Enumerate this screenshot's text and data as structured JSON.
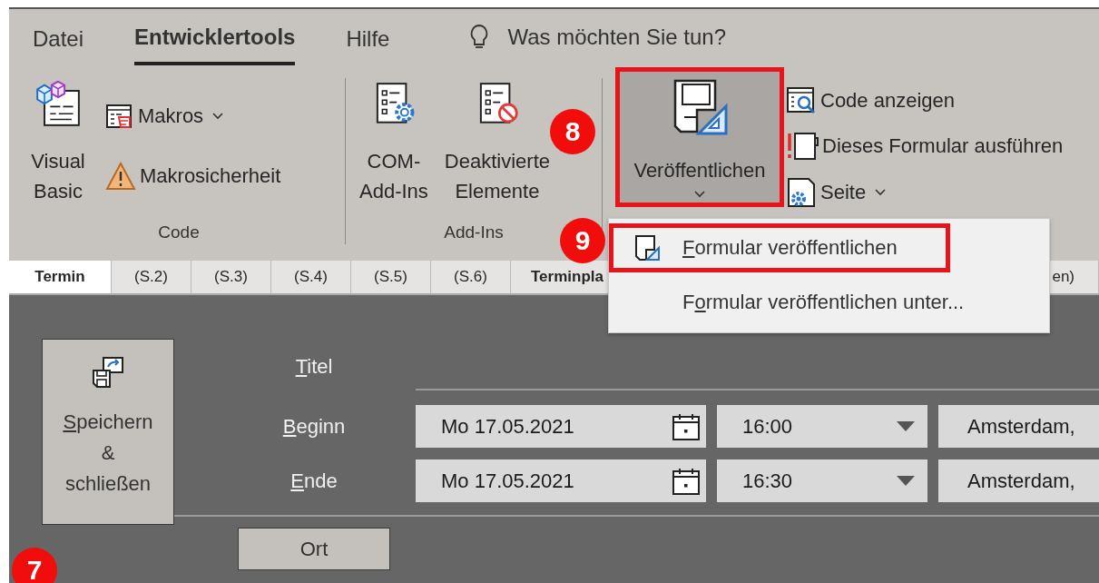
{
  "ribbon_tabs": [
    {
      "label": "Datei",
      "selected": false
    },
    {
      "label": "Entwicklertools",
      "selected": true
    },
    {
      "label": "Hilfe",
      "selected": false
    }
  ],
  "tell_me": {
    "placeholder": "Was möchten Sie tun?"
  },
  "ribbon_groups": [
    {
      "label": "Code",
      "items": [
        {
          "kind": "large",
          "lines": [
            "Visual",
            "Basic"
          ],
          "dropdown": false,
          "pressed": false,
          "framed": false
        },
        {
          "kind": "stack",
          "buttons": [
            {
              "label": "Makros",
              "dropdown": true
            },
            {
              "label": "Makrosicherheit",
              "dropdown": false
            }
          ]
        }
      ]
    },
    {
      "label": "Add-Ins",
      "items": [
        {
          "kind": "large",
          "lines": [
            "COM-",
            "Add-Ins"
          ],
          "dropdown": false,
          "pressed": false,
          "framed": false
        },
        {
          "kind": "large",
          "lines": [
            "Deaktivierte",
            "Elemente"
          ],
          "dropdown": false,
          "pressed": false,
          "framed": false
        }
      ]
    },
    {
      "items": [
        {
          "kind": "large",
          "lines": [
            "Veröffentlichen"
          ],
          "dropdown": true,
          "pressed": true,
          "framed": true
        },
        {
          "kind": "stack",
          "buttons": [
            {
              "label": "Code anzeigen",
              "dropdown": false
            },
            {
              "label": "Dieses Formular ausführen",
              "dropdown": false
            },
            {
              "label": "Seite",
              "dropdown": true
            }
          ]
        }
      ]
    }
  ],
  "publish_menu": {
    "items": [
      {
        "label": [
          {
            "text": "F",
            "underline": true
          },
          {
            "text": "ormular veröffentlichen",
            "underline": false
          }
        ],
        "has_icon": true,
        "framed": true
      },
      {
        "label": [
          {
            "text": "F",
            "underline": false
          },
          {
            "text": "o",
            "underline": true
          },
          {
            "text": "rmular veröffentlichen unter...",
            "underline": false
          }
        ],
        "has_icon": false,
        "framed": false
      }
    ]
  },
  "form_tabs": [
    {
      "label": "Termin",
      "selected": true
    },
    {
      "label": "(S.2)",
      "selected": false
    },
    {
      "label": "(S.3)",
      "selected": false
    },
    {
      "label": "(S.4)",
      "selected": false
    },
    {
      "label": "(S.5)",
      "selected": false
    },
    {
      "label": "(S.6)",
      "selected": false
    },
    {
      "label": "Terminpla",
      "selected": false
    },
    {
      "label": "en)",
      "selected": false
    }
  ],
  "form": {
    "save_button": {
      "lines": [
        [
          {
            "text": "S",
            "underline": true
          },
          {
            "text": "peichern",
            "underline": false
          }
        ],
        [
          {
            "text": "&",
            "underline": false
          }
        ],
        [
          {
            "text": "schließen",
            "underline": false
          }
        ]
      ]
    },
    "rows": [
      {
        "kind": "title",
        "label": [
          {
            "text": "T",
            "underline": true
          },
          {
            "text": "itel",
            "underline": false
          }
        ]
      },
      {
        "kind": "datetime",
        "label": [
          {
            "text": "B",
            "underline": true
          },
          {
            "text": "eginn",
            "underline": false
          }
        ],
        "date": "Mo 17.05.2021",
        "time": "16:00",
        "timezone": "Amsterdam,"
      },
      {
        "kind": "datetime",
        "label": [
          {
            "text": "E",
            "underline": true
          },
          {
            "text": "nde",
            "underline": false
          }
        ],
        "date": "Mo 17.05.2021",
        "time": "16:30",
        "timezone": "Amsterdam,"
      },
      {
        "kind": "location",
        "button": "Ort"
      }
    ]
  },
  "badges": [
    {
      "number": "8"
    },
    {
      "number": "9"
    },
    {
      "number": "7"
    }
  ]
}
